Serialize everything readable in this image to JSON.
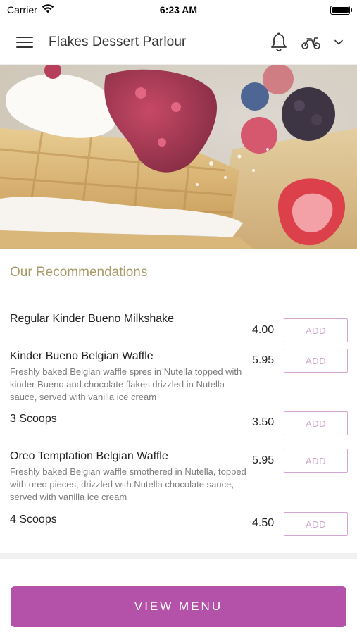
{
  "status_bar": {
    "carrier": "Carrier",
    "time": "6:23 AM"
  },
  "nav": {
    "title": "Flakes Dessert Parlour",
    "icons": [
      "menu-icon",
      "bell-icon",
      "scooter-icon",
      "chevron-down-icon"
    ]
  },
  "recommendations": {
    "title": "Our Recommendations",
    "add_label": "ADD",
    "items": [
      {
        "name": "Regular Kinder Bueno Milkshake",
        "description": "",
        "price": "4.00"
      },
      {
        "name": "Kinder Bueno Belgian Waffle",
        "description": "Freshly baked Belgian waffle spres in Nutella topped with kinder Bueno and chocolate flakes drizzled in Nutella sauce, served with vanilla ice cream",
        "price": "5.95"
      },
      {
        "name": "3 Scoops",
        "description": "",
        "price": "3.50"
      },
      {
        "name": "Oreo Temptation Belgian Waffle",
        "description": "Freshly baked Belgian waffle smothered in Nutella, topped with oreo pieces, drizzled with Nutella chocolate sauce, served with vanilla ice cream",
        "price": "5.95"
      },
      {
        "name": "4 Scoops",
        "description": "",
        "price": "4.50"
      }
    ]
  },
  "footer": {
    "view_menu_label": "VIEW MENU"
  },
  "colors": {
    "accent": "#b452aa",
    "section_title": "#a89a6a",
    "add_border": "#d6a6d2"
  }
}
